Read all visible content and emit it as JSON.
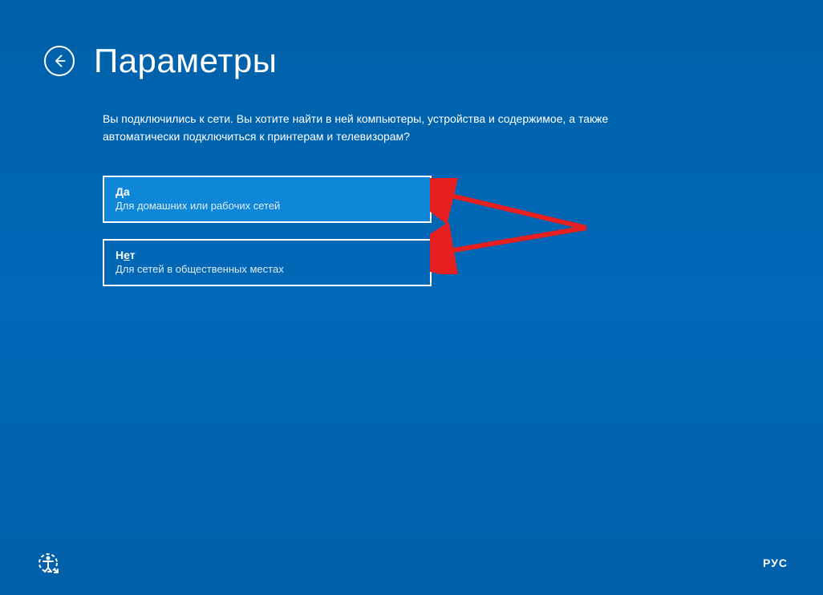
{
  "header": {
    "title": "Параметры"
  },
  "description": "Вы подключились к сети. Вы хотите найти в ней компьютеры, устройства и содержимое, а также автоматически подключиться к принтерам и телевизорам?",
  "options": [
    {
      "title_prefix": "Д",
      "title_rest": "а",
      "subtitle": "Для домашних или рабочих сетей",
      "selected": true
    },
    {
      "title_prefix": "Н",
      "title_underline": "е",
      "title_rest": "т",
      "subtitle": "Для сетей в общественных местах",
      "selected": false
    }
  ],
  "footer": {
    "language": "РУС"
  },
  "colors": {
    "background": "#0060a8",
    "selected_bg": "#0f87d8",
    "arrow": "#e62020"
  }
}
